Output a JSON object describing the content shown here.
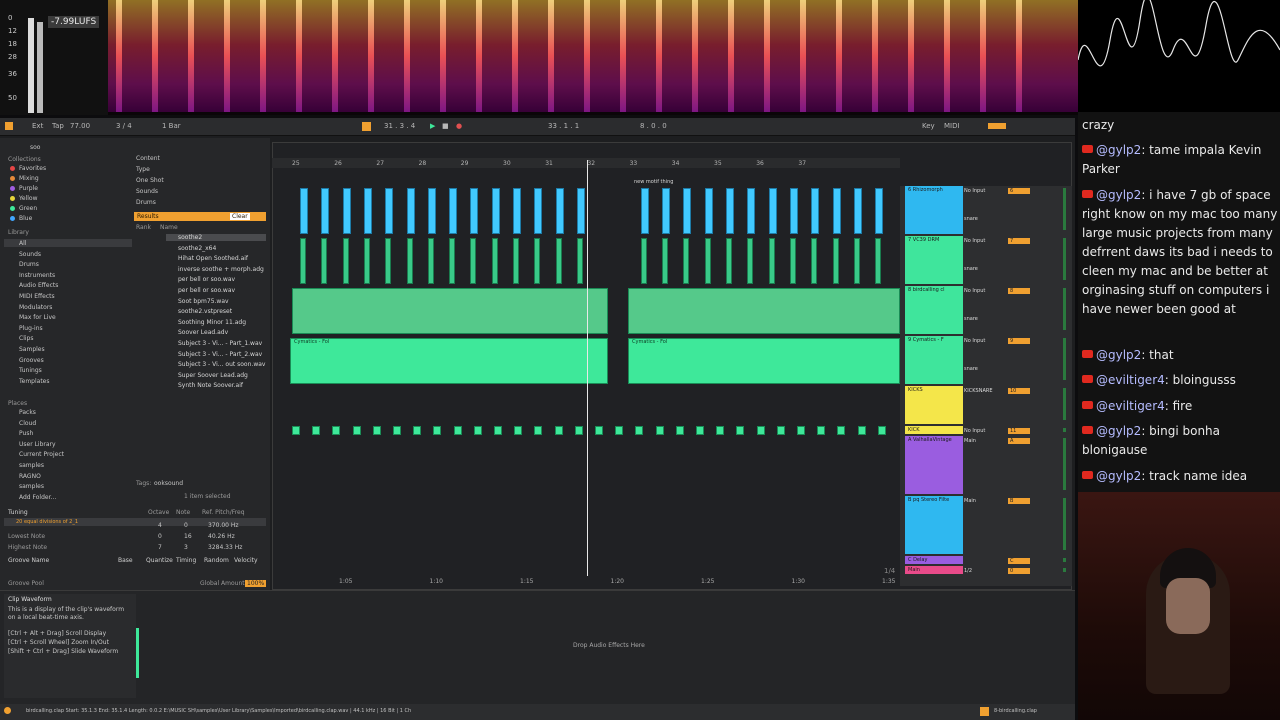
{
  "meter": {
    "lufs": "-7.99LUFS",
    "ticks": [
      "0",
      "12",
      "18",
      "28",
      "36",
      "50"
    ]
  },
  "toolbar": {
    "ext": "Ext",
    "tap": "Tap",
    "tempo": "77.00",
    "sig": "3 / 4",
    "quant": "1 Bar",
    "position": "31 . 3 . 4",
    "loop_pos": "33 . 1 . 1",
    "loop_len": "8 . 0 . 0",
    "key": "Key",
    "midi": "MIDI"
  },
  "browser": {
    "search": "soo",
    "collections_label": "Collections",
    "collections": [
      "Favorites",
      "Mixing",
      "Purple",
      "Yellow",
      "Green",
      "Blue"
    ],
    "library_label": "Library",
    "library": [
      "All",
      "Sounds",
      "Drums",
      "Instruments",
      "Audio Effects",
      "MIDI Effects",
      "Modulators",
      "Max for Live",
      "Plug-ins",
      "Clips",
      "Samples",
      "Grooves",
      "Tunings",
      "Templates"
    ],
    "places_label": "Places",
    "places": [
      "Packs",
      "Cloud",
      "Push",
      "User Library",
      "Current Project",
      "samples",
      "RAGNO",
      "samples",
      "Add Folder..."
    ],
    "filters": [
      "Content",
      "Type",
      "One Shot",
      "Sounds",
      "Drums"
    ],
    "results_label": "Results",
    "clear_label": "Clear",
    "col_rank": "Rank",
    "col_name": "Name",
    "results": [
      "soothe2",
      "soothe2_x64",
      "Hihat Open Soothed.aif",
      "inverse soothe + morph.adg",
      "per bell or soo.wav",
      "per bell or soo.wav",
      "Soot bpm75.wav",
      "soothe2.vstpreset",
      "Soothing Minor 11.adg",
      "Soover Lead.adv",
      "Subject 3 - Vi... - Part_1.wav",
      "Subject 3 - Vi... - Part_2.wav",
      "Subject 3 - Vi... out soon.wav",
      "Super Soover Lead.adg",
      "Synth Note Soover.aif"
    ],
    "tags_label": "Tags:",
    "tag": "ooksound",
    "selected": "1 item selected"
  },
  "tuning": {
    "label": "Tuning",
    "cols": [
      "Octave",
      "Note",
      "Ref. Pitch/Freq"
    ],
    "selected_name": "20 equal divisions of 2_1",
    "rows": [
      {
        "name": "",
        "octave": "4",
        "note": "0",
        "freq": "370.00 Hz"
      },
      {
        "name": "Lowest Note",
        "octave": "0",
        "note": "16",
        "freq": "40.26 Hz"
      },
      {
        "name": "Highest Note",
        "octave": "7",
        "note": "3",
        "freq": "3284.33 Hz"
      }
    ]
  },
  "groove": {
    "cols": [
      "Groove Name",
      "Base",
      "Quantize",
      "Timing",
      "Random",
      "Velocity"
    ],
    "pool_label": "Groove Pool",
    "global_label": "Global Amount",
    "global_value": "100%"
  },
  "help": {
    "title": "Clip Waveform",
    "body": "This is a display of the clip's waveform on a local beat-time axis.",
    "shortcuts": [
      "[Ctrl + Alt + Drag] Scroll Display",
      "[Ctrl + Scroll Wheel] Zoom In/Out",
      "[Shift + Ctrl + Drag] Slide Waveform"
    ]
  },
  "arrangement": {
    "ruler": [
      "25",
      "26",
      "27",
      "28",
      "29",
      "30",
      "31",
      "32",
      "33",
      "34",
      "35",
      "36",
      "37"
    ],
    "marker": "new motif thing",
    "time_ruler": [
      "1:05",
      "1:10",
      "1:15",
      "1:20",
      "1:25",
      "1:30",
      "1:35"
    ],
    "clip_label": "Cymatics - Fol",
    "drop_label": "Drop Audio Effects Here",
    "zoom": "1/4"
  },
  "tracks": [
    {
      "name": "6 Rhizomorph",
      "input": "No Input",
      "route": "snare",
      "vol": "6",
      "color": "#2fb8f0"
    },
    {
      "name": "7 VC39 DRM",
      "input": "No Input",
      "route": "snare",
      "vol": "7",
      "color": "#3fe59c"
    },
    {
      "name": "8 birdcalling cl",
      "input": "No Input",
      "route": "snare",
      "vol": "8",
      "color": "#3fe59c"
    },
    {
      "name": "9 Cymatics - F",
      "input": "No Input",
      "route": "snare",
      "vol": "9",
      "color": "#3fe59c"
    },
    {
      "name": "KICKS",
      "input": "KICKSNARE",
      "route": "",
      "vol": "10",
      "color": "#f4e64a"
    },
    {
      "name": "KICK",
      "input": "No Input",
      "route": "",
      "vol": "11",
      "color": "#f4e64a"
    },
    {
      "name": "A ValhallaVintage",
      "input": "Main",
      "route": "",
      "vol": "A",
      "color": "#9a5de0"
    },
    {
      "name": "B pq Stereo Filte",
      "input": "Main",
      "route": "",
      "vol": "B",
      "color": "#2fb8f0"
    },
    {
      "name": "C Delay",
      "input": "",
      "route": "",
      "vol": "C",
      "color": "#9a5de0"
    },
    {
      "name": "Main",
      "input": "1/2",
      "route": "",
      "vol": "0",
      "color": "#e94b8a"
    }
  ],
  "status": {
    "text": "birdcalling.clap  Start: 35.1.3  End: 35.1.4  Length: 0.0.2  E:\\MUSIC SH\\samples\\User Library\\Samples\\Imported\\birdcalling.clap.wav | 44.1 kHz | 16 Bit | 1 Ch",
    "clip": "8-birdcalling.clap"
  },
  "chat": [
    {
      "user": "",
      "text": "crazy"
    },
    {
      "user": "@gylp2",
      "text": "tame impala Kevin Parker"
    },
    {
      "user": "@gylp2",
      "text": "i have 7 gb of space right know on my mac too many large music projects from many defrrent daws its bad i needs to cleen my mac and be better at orginasing stuff on computers i have newer been good at"
    },
    {
      "user": "@gylp2",
      "text": "that"
    },
    {
      "user": "@eviltiger4",
      "text": "bloingusss"
    },
    {
      "user": "@eviltiger4",
      "text": "fire"
    },
    {
      "user": "@gylp2",
      "text": "bingi bonha blonigause"
    },
    {
      "user": "@gylp2",
      "text": "track name idea"
    }
  ],
  "colors": {
    "accent": "#f0a030",
    "blue_clip": "#41c9ff",
    "green_clip": "#3ee89a",
    "yellow_track": "#f4e64a",
    "purple_track": "#9a5de0"
  }
}
